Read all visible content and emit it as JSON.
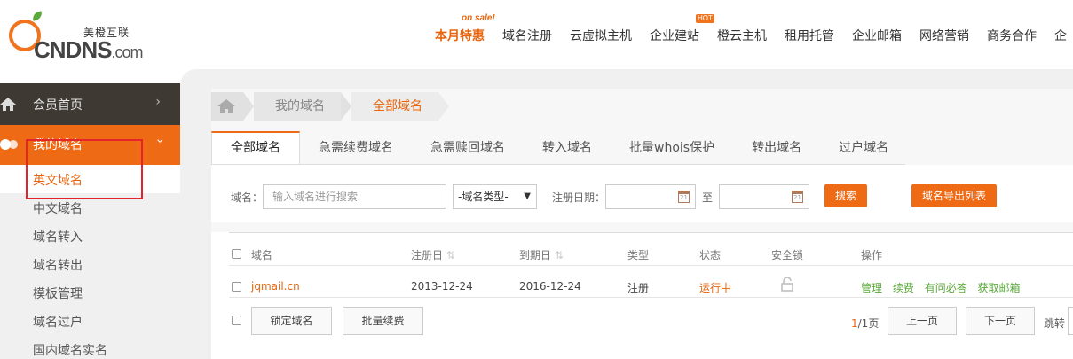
{
  "header": {
    "logo_cn": "美橙互联",
    "logo_brand": "CNDNS",
    "logo_suffix": ".com",
    "nav": [
      {
        "label": "本月特惠",
        "badge": "on sale!"
      },
      {
        "label": "域名注册"
      },
      {
        "label": "云虚拟主机"
      },
      {
        "label": "企业建站",
        "badge": "HOT"
      },
      {
        "label": "橙云主机"
      },
      {
        "label": "租用托管"
      },
      {
        "label": "企业邮箱"
      },
      {
        "label": "网络营销"
      },
      {
        "label": "商务合作"
      },
      {
        "label": "企"
      }
    ]
  },
  "sidebar": {
    "home": "会员首页",
    "my_domain": "我的域名",
    "items": [
      "英文域名",
      "中文域名",
      "域名转入",
      "域名转出",
      "模板管理",
      "域名过户",
      "国内域名实名"
    ]
  },
  "breadcrumb": [
    "我的域名",
    "全部域名"
  ],
  "tabs": [
    "全部域名",
    "急需续费域名",
    "急需赎回域名",
    "转入域名",
    "批量whois保护",
    "转出域名",
    "过户域名"
  ],
  "filter": {
    "domain_label": "域名：",
    "domain_placeholder": "输入域名进行搜索",
    "type_select": "-域名类型-",
    "date_label": "注册日期：",
    "to_label": "至",
    "search_button": "搜索",
    "export_button": "域名导出列表"
  },
  "table": {
    "headers": {
      "domain": "域名",
      "reg_date": "注册日",
      "exp_date": "到期日",
      "type": "类型",
      "status": "状态",
      "lock": "安全锁",
      "ops": "操作"
    },
    "rows": [
      {
        "domain": "jqmail.cn",
        "reg_date": "2013-12-24",
        "exp_date": "2016-12-24",
        "type": "注册",
        "status": "运行中",
        "ops": [
          "管理",
          "续费",
          "有问必答",
          "获取邮箱"
        ]
      }
    ],
    "lock_button": "锁定域名",
    "renew_button": "批量续费"
  },
  "pager": {
    "current": "1",
    "total": "/1页",
    "prev": "上一页",
    "next": "下一页",
    "jump": "跳转"
  }
}
